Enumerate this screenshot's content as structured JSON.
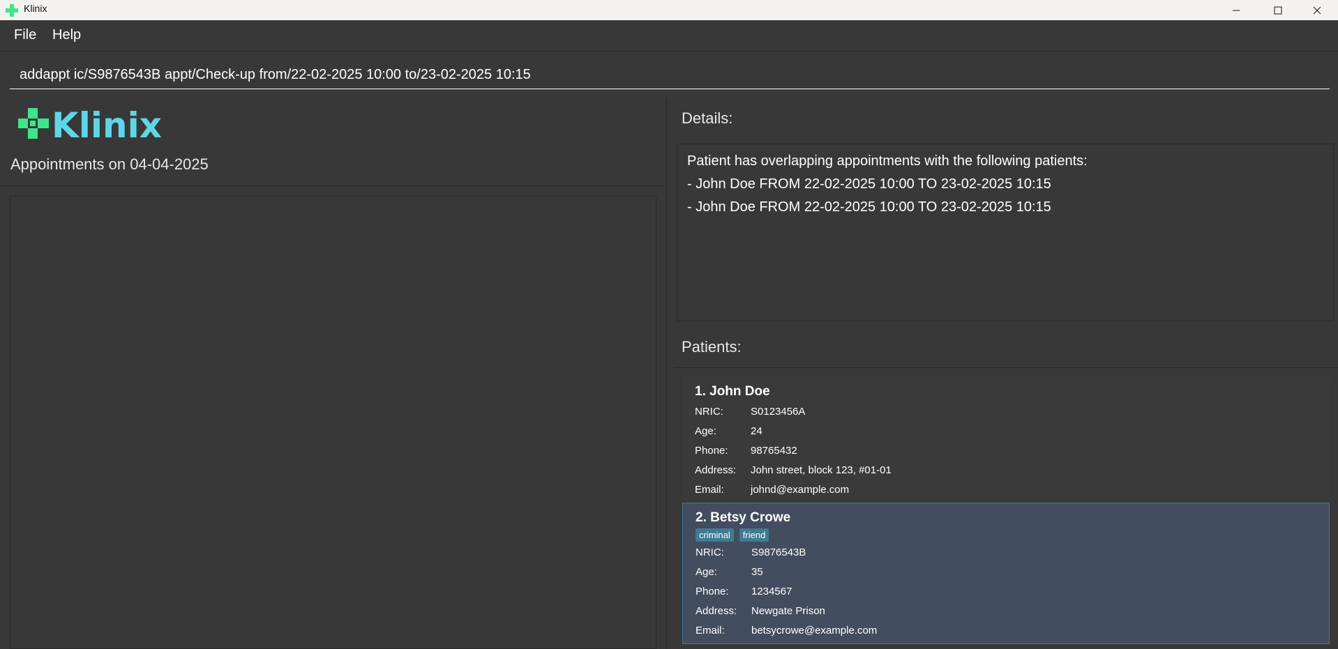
{
  "window": {
    "title": "Klinix",
    "minimize_icon": "minimize-icon",
    "maximize_icon": "maximize-icon",
    "close_icon": "close-icon"
  },
  "menu": {
    "items": [
      {
        "label": "File"
      },
      {
        "label": "Help"
      }
    ]
  },
  "command": {
    "value": "addappt ic/S9876543B appt/Check-up from/22-02-2025 10:00 to/23-02-2025 10:15"
  },
  "logo": {
    "text": "Klinix",
    "accent_color": "#3ee68a",
    "text_color": "#5fd6e8"
  },
  "appointments": {
    "title": "Appointments on 04-04-2025",
    "items": []
  },
  "details": {
    "label": "Details:",
    "lines": [
      "Patient has overlapping appointments with the following patients:",
      "- John Doe FROM 22-02-2025 10:00 TO 23-02-2025 10:15",
      "- John Doe FROM 22-02-2025 10:00 TO 23-02-2025 10:15"
    ]
  },
  "patients": {
    "label": "Patients:",
    "field_labels": {
      "nric": "NRIC:",
      "age": "Age:",
      "phone": "Phone:",
      "address": "Address:",
      "email": "Email:"
    },
    "items": [
      {
        "name": "1. John Doe",
        "tags": [],
        "nric": "S0123456A",
        "age": "24",
        "phone": "98765432",
        "address": "John street, block 123, #01-01",
        "email": "johnd@example.com"
      },
      {
        "name": "2. Betsy Crowe",
        "tags": [
          "criminal",
          "friend"
        ],
        "nric": "S9876543B",
        "age": "35",
        "phone": "1234567",
        "address": "Newgate Prison",
        "email": "betsycrowe@example.com"
      }
    ]
  }
}
